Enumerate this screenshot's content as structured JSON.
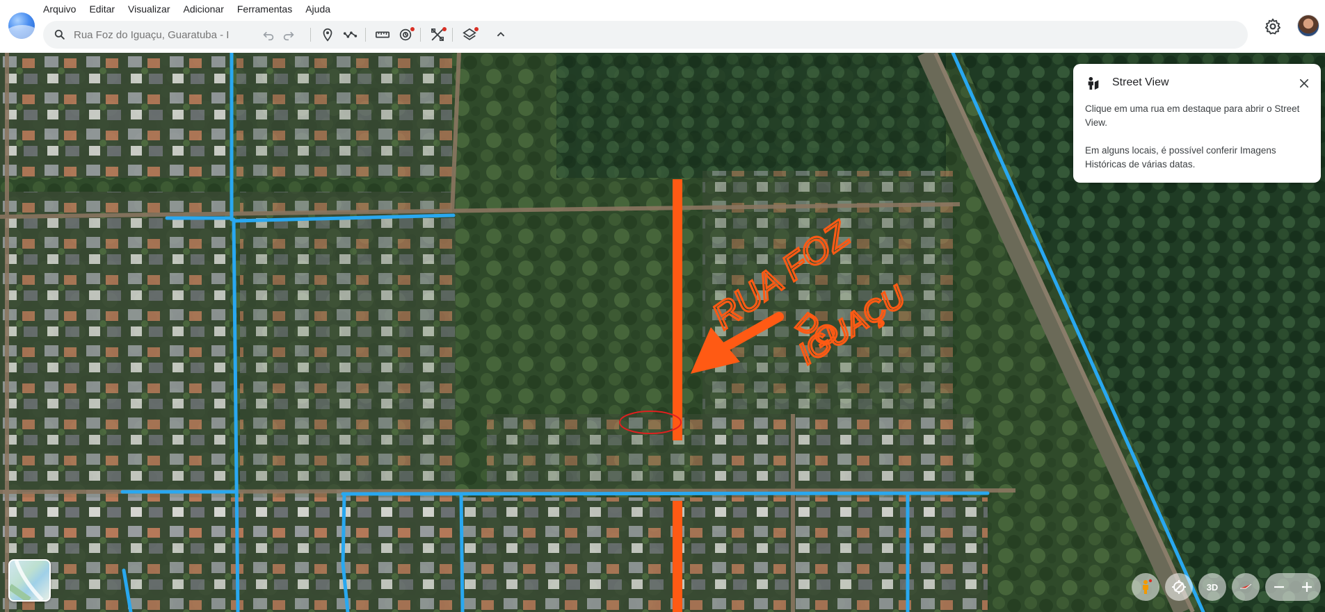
{
  "menu": [
    "Arquivo",
    "Editar",
    "Visualizar",
    "Adicionar",
    "Ferramentas",
    "Ajuda"
  ],
  "search": {
    "value": "",
    "placeholder": "Rua Foz do Iguaçu, Guaratuba - I"
  },
  "toolbar_icons": [
    "search-icon",
    "undo-icon",
    "redo-icon",
    "placemark-icon",
    "path-icon",
    "ruler-icon",
    "history-icon",
    "tools-icon",
    "layers-icon",
    "collapse-chevron-icon"
  ],
  "street_view_panel": {
    "title": "Street View",
    "body1": "Clique em uma rua em destaque para abrir o Street View.",
    "body2": "Em alguns locais, é possível conferir Imagens Históricas de várias datas."
  },
  "annotation": {
    "line1": "RUA FOZ",
    "line2": "DO",
    "line3": "IGUAÇU",
    "color": "#ff5a14"
  },
  "controls": {
    "three_d_label": "3D"
  },
  "colors": {
    "street_view_roads": "#29a8f0",
    "accent_dot": "#d93025"
  }
}
